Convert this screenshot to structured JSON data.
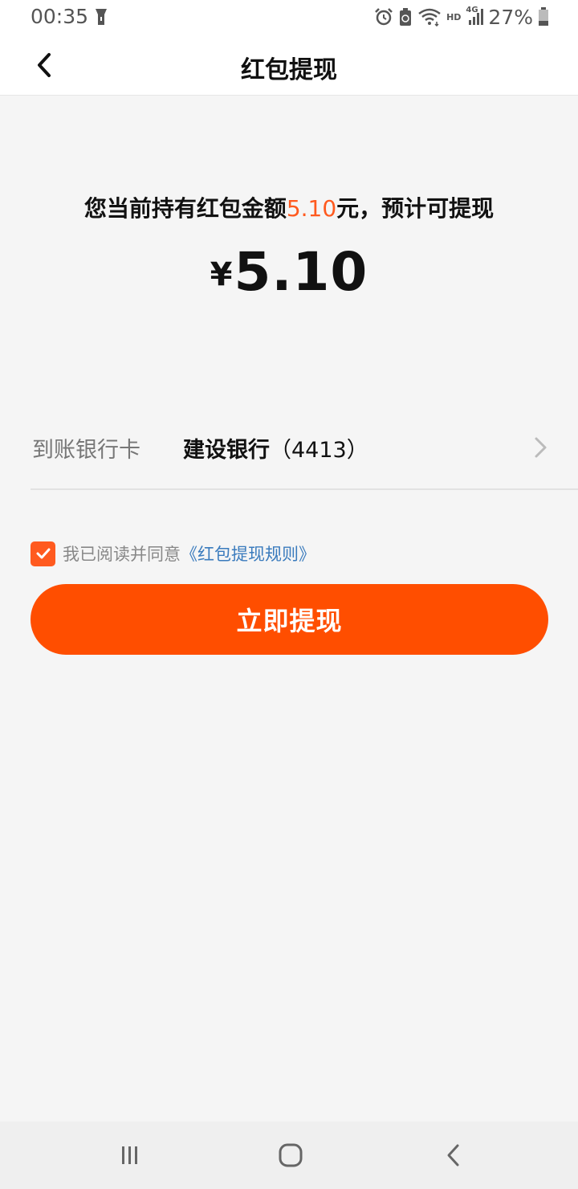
{
  "status_bar": {
    "time": "00:35",
    "battery_percent": "27%",
    "network_label": "HD",
    "signal_label": "4G",
    "icons": [
      "flashlight-icon",
      "alarm-icon",
      "battery-saver-icon",
      "wifi-icon",
      "signal-icon",
      "battery-icon"
    ]
  },
  "nav": {
    "title": "红包提现",
    "back_icon": "chevron-left-icon"
  },
  "balance": {
    "prefix": "您当前持有红包金额",
    "amount_highlight": "5.10",
    "suffix": "元，预计可提现",
    "currency_symbol": "¥",
    "withdraw_amount": "5.10"
  },
  "bank": {
    "label": "到账银行卡",
    "bank_name": "建设银行",
    "card_suffix": "（4413）"
  },
  "agreement": {
    "checked": true,
    "text": "我已阅读并同意",
    "link_text": "《红包提现规则》"
  },
  "submit": {
    "label": "立即提现"
  },
  "colors": {
    "accent": "#ff4e00",
    "highlight": "#ff5a1f",
    "link": "#3a7bbd"
  },
  "system_nav": {
    "icons": [
      "recent-apps-icon",
      "home-icon",
      "back-icon"
    ]
  }
}
